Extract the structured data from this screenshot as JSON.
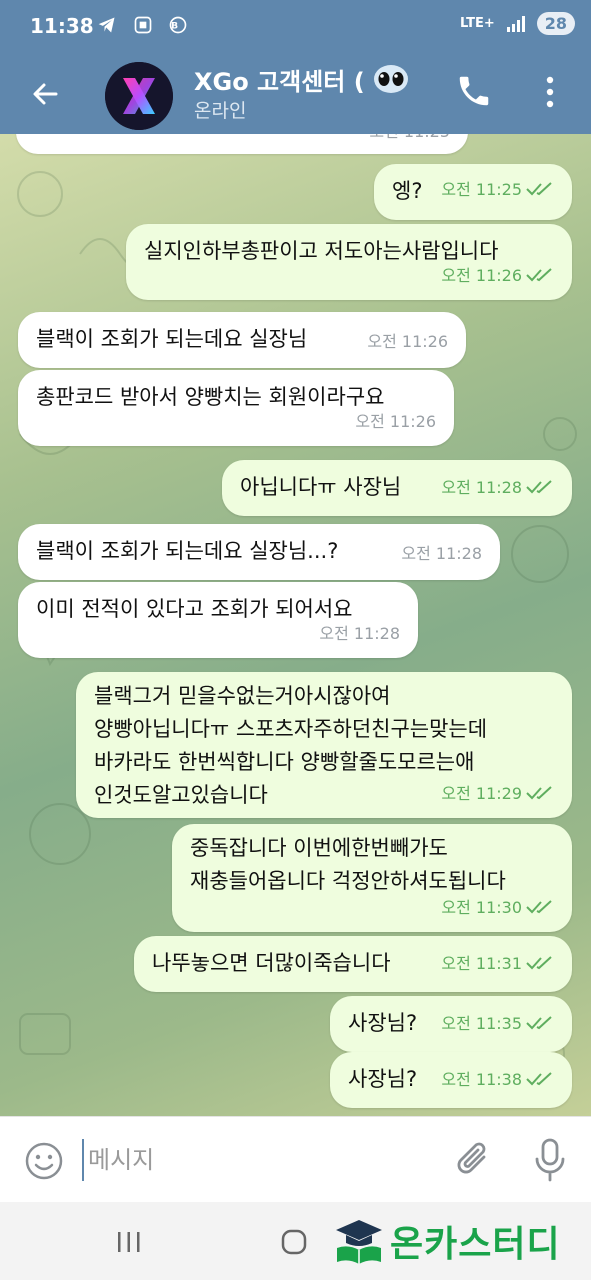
{
  "status_bar": {
    "time": "11:38",
    "network": "LTE+",
    "battery": "28",
    "left_icons": [
      "telegram-icon",
      "scan-icon",
      "shield-icon"
    ]
  },
  "header": {
    "title": "XGo 고객센터 (",
    "status": "온라인",
    "back_icon": "arrow-back-icon",
    "call_icon": "phone-icon",
    "menu_icon": "more-vert-icon",
    "avatar_letter": "X"
  },
  "messages": [
    {
      "dir": "in",
      "text": "",
      "time": "오전 11:25",
      "partial": true
    },
    {
      "dir": "out",
      "text": "엥?",
      "time": "오전 11:25"
    },
    {
      "dir": "out",
      "text": "실지인하부총판이고 저도아는사람입니다",
      "time": "오전 11:26"
    },
    {
      "dir": "in",
      "text": "블랙이 조회가 되는데요 실장님",
      "time": "오전 11:26"
    },
    {
      "dir": "in",
      "text": "총판코드 받아서 양빵치는 회원이라구요",
      "time": "오전 11:26"
    },
    {
      "dir": "out",
      "text": "아닙니다ㅠ 사장님",
      "time": "오전 11:28"
    },
    {
      "dir": "in",
      "text": "블랙이 조회가 되는데요 실장님...?",
      "time": "오전 11:28"
    },
    {
      "dir": "in",
      "text": "이미 전적이 있다고 조회가 되어서요",
      "time": "오전 11:28"
    },
    {
      "dir": "out",
      "text": "블랙그거 믿을수없는거아시잖아여\n양빵아닙니다ㅠ 스포츠자주하던친구는맞는데\n바카라도 한번씩합니다 양빵할줄도모르는애\n인것도알고있습니다",
      "time": "오전 11:29"
    },
    {
      "dir": "out",
      "text": "중독잡니다 이번에한번빼가도\n재충들어옵니다 걱정안하셔도됩니다",
      "time": "오전 11:30"
    },
    {
      "dir": "out",
      "text": "나뚜놓으면 더많이죽습니다",
      "time": "오전 11:31"
    },
    {
      "dir": "out",
      "text": "사장님?",
      "time": "오전 11:35"
    },
    {
      "dir": "out",
      "text": "사장님?",
      "time": "오전 11:38"
    }
  ],
  "input": {
    "placeholder": "메시지",
    "emoji_icon": "emoji-icon",
    "attach_icon": "paperclip-icon",
    "mic_icon": "microphone-icon"
  },
  "nav": {
    "recent_icon": "recent-apps-icon",
    "home_icon": "home-icon"
  },
  "watermark": {
    "text": "온카스터디",
    "icon": "graduation-book-icon"
  },
  "colors": {
    "header": "#5f87ad",
    "bubble_out": "#effdde",
    "bubble_in": "#ffffff",
    "tick": "#5fae5f",
    "watermark": "#1aa34a"
  }
}
